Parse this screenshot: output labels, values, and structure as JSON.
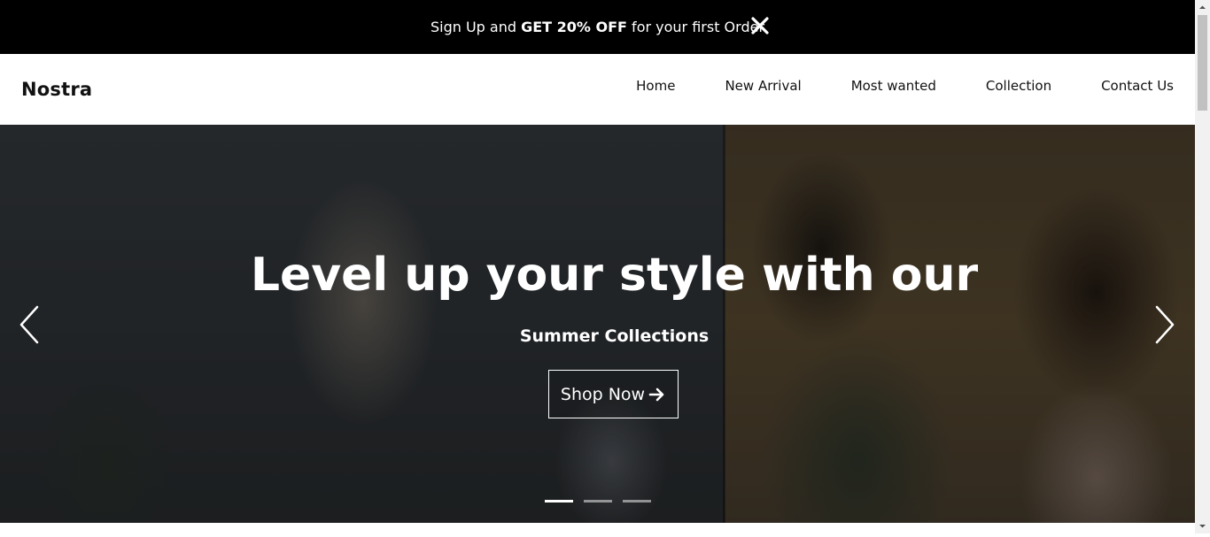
{
  "promo": {
    "prefix": "Sign Up and ",
    "highlight": "GET 20% OFF",
    "suffix": " for your first Order",
    "close_icon": "close-icon"
  },
  "header": {
    "brand": "Nostra",
    "nav": [
      "Home",
      "New Arrival",
      "Most wanted",
      "Collection",
      "Contact Us"
    ]
  },
  "hero": {
    "headline": "Level up your style with our",
    "subheadline": "Summer Collections",
    "cta_label": "Shop Now",
    "cta_icon": "arrow-right-icon",
    "prev_icon": "chevron-left-icon",
    "next_icon": "chevron-right-icon",
    "slides_total": 3,
    "active_slide": 1
  },
  "colors": {
    "promo_bg": "#000000",
    "text_dark": "#111111",
    "hero_text": "#ffffff"
  }
}
